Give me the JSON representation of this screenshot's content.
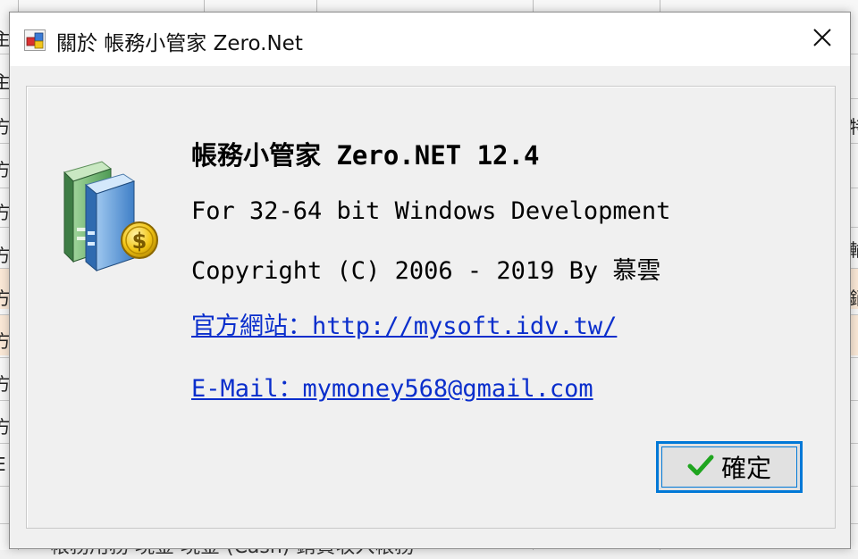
{
  "dialog": {
    "title": "關於 帳務小管家 Zero.Net",
    "product_name": "帳務小管家 Zero.NET 12.4",
    "platform_line": "For 32-64 bit Windows Development",
    "copyright_line": "Copyright (C) 2006 - 2019 By 慕雲",
    "website_link": "官方網站：http://mysoft.idv.tw/",
    "email_link": "E-Mail：mymoney568@gmail.com",
    "ok_button": {
      "label": "確定",
      "icon": "checkmark-icon"
    },
    "close_icon": "close-icon",
    "app_icon": "app-icon",
    "logo_icon": "books-dollar-icon"
  },
  "background": {
    "left_fragments": [
      "主",
      "主",
      "方",
      "方",
      "方",
      "方",
      "方",
      "方",
      "方",
      "方",
      "E"
    ],
    "right_fragments": [
      "特",
      "輸",
      "銷"
    ],
    "bottom_text": "帳務用務   現金   現金 (Cash)        銷貨收入帳務"
  },
  "colors": {
    "accent": "#0078d7",
    "link": "#0a2ecc",
    "check": "#1fa51f"
  }
}
